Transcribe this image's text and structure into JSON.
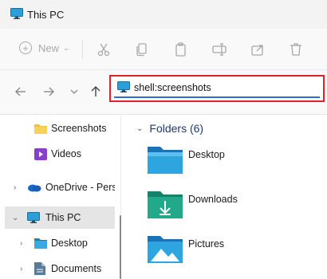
{
  "window": {
    "title": "This PC",
    "icon": "monitor-icon"
  },
  "toolbar": {
    "new_label": "New",
    "icons": [
      "new-icon",
      "cut-icon",
      "copy-icon",
      "paste-icon",
      "rename-icon",
      "share-icon",
      "delete-icon"
    ]
  },
  "nav": {
    "back_icon": "arrow-left-icon",
    "forward_icon": "arrow-right-icon",
    "recent_icon": "chevron-down-icon",
    "up_icon": "arrow-up-icon"
  },
  "address": {
    "value": "shell:screenshots"
  },
  "sidebar": {
    "items": [
      {
        "label": "Screenshots",
        "icon": "folder-icon"
      },
      {
        "label": "Videos",
        "icon": "videos-icon"
      },
      {
        "label": "OneDrive - Perso",
        "icon": "onedrive-icon"
      },
      {
        "label": "This PC",
        "icon": "monitor-icon"
      },
      {
        "label": "Desktop",
        "icon": "desktop-folder-icon"
      },
      {
        "label": "Documents",
        "icon": "documents-icon"
      }
    ]
  },
  "main": {
    "group_title": "Folders (6)",
    "folders": [
      {
        "label": "Desktop",
        "icon": "desktop-folder-icon"
      },
      {
        "label": "Downloads",
        "icon": "downloads-folder-icon"
      },
      {
        "label": "Pictures",
        "icon": "pictures-folder-icon"
      }
    ]
  },
  "colors": {
    "accent": "#2a6fd6",
    "highlight_border": "#e0202a",
    "selected_bg": "#e5e5e5"
  }
}
